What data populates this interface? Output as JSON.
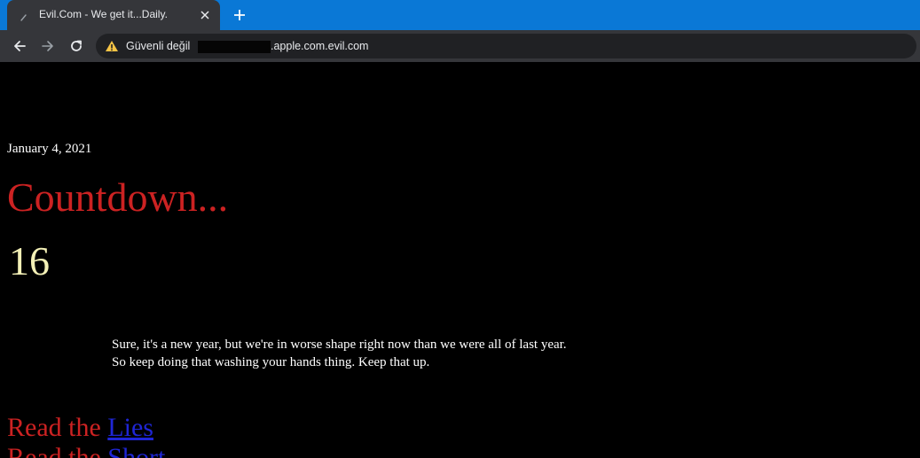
{
  "browser": {
    "tab": {
      "title": "Evil.Com - We get it...Daily."
    },
    "omnibox": {
      "security_label": "Güvenli değil",
      "url_visible": ".apple.com.evil.com"
    }
  },
  "page": {
    "date": "January 4, 2021",
    "headline": "Countdown...",
    "counter": "16",
    "paragraph": [
      "Sure, it's a new year, but we're in worse shape right now than we were all of last year.",
      "So keep doing that washing your hands thing. Keep that up."
    ],
    "links": [
      {
        "prefix": "Read the ",
        "link_text": "Lies"
      },
      {
        "prefix": "Read the ",
        "link_text": "Short"
      }
    ]
  },
  "colors": {
    "tabstrip": "#0a78d6",
    "headline": "#cc2222",
    "counter": "#f3f0b6",
    "link": "#1f26d6"
  }
}
